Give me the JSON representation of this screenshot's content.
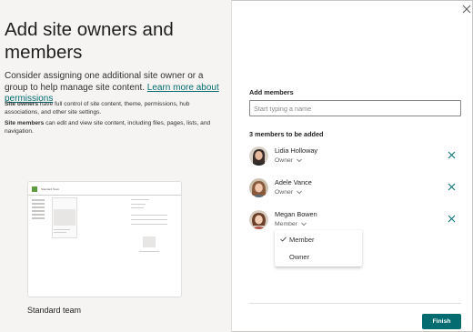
{
  "panel": {
    "title": "Add site owners and members",
    "intro_text": "Consider assigning one additional site owner or a group to help manage site content. ",
    "learn_more_link": "Learn more about permissions",
    "owners_term": "Site owners",
    "owners_desc": " have full control of site content, theme, permissions, hub associations, and other site settings.",
    "members_term": "Site members",
    "members_desc": " can edit and view site content, including files, pages, lists, and navigation."
  },
  "template": {
    "name": "Standard team",
    "preview_title": "Standard Team"
  },
  "form": {
    "add_members_label": "Add members",
    "search_placeholder": "Start typing a name",
    "count_text": "3 members to be added"
  },
  "members": [
    {
      "name": "Lidia Holloway",
      "role": "Owner"
    },
    {
      "name": "Adele Vance",
      "role": "Owner"
    },
    {
      "name": "Megan Bowen",
      "role": "Member"
    }
  ],
  "role_dropdown": {
    "options": [
      "Member",
      "Owner"
    ],
    "selected": "Member"
  },
  "actions": {
    "finish_label": "Finish"
  },
  "colors": {
    "accent": "#036c70",
    "panel_bg": "#f5f4f2"
  },
  "icons": {
    "close": "close-icon",
    "remove": "remove-icon",
    "chevron": "chevron-down-icon",
    "check": "checkmark-icon"
  }
}
